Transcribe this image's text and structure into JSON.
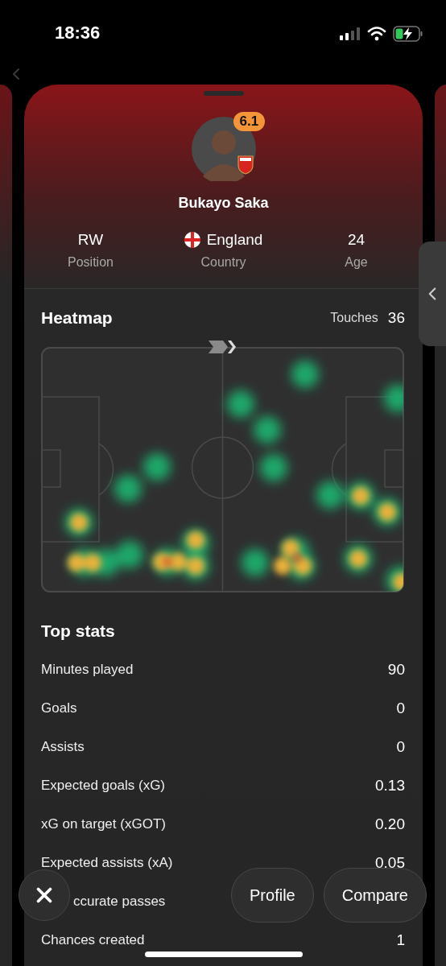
{
  "status_bar": {
    "time": "18:36"
  },
  "player": {
    "rating": "6.1",
    "name": "Bukayo Saka"
  },
  "info": [
    {
      "value": "RW",
      "label": "Position",
      "kind": "text"
    },
    {
      "value": "England",
      "label": "Country",
      "kind": "flag"
    },
    {
      "value": "24",
      "label": "Age",
      "kind": "text"
    }
  ],
  "heatmap": {
    "title": "Heatmap",
    "touches_label": "Touches",
    "touches": "36"
  },
  "top_stats": {
    "title": "Top stats",
    "rows": [
      {
        "label": "Minutes played",
        "value": "90",
        "kind": "full"
      },
      {
        "label": "Goals",
        "value": "0",
        "kind": "full"
      },
      {
        "label": "Assists",
        "value": "0",
        "kind": "full"
      },
      {
        "label": "Expected goals (xG)",
        "value": "0.13",
        "kind": "full"
      },
      {
        "label": "xG on target (xGOT)",
        "value": "0.20",
        "kind": "full"
      },
      {
        "label": "Expected assists (xA)",
        "value": "0.05",
        "kind": "full"
      },
      {
        "label": "ccurate passes",
        "kind": "covered"
      },
      {
        "label": "Chances created",
        "value": "1",
        "kind": "full"
      }
    ]
  },
  "actions": {
    "buttons": [
      "Profile",
      "Compare"
    ]
  }
}
